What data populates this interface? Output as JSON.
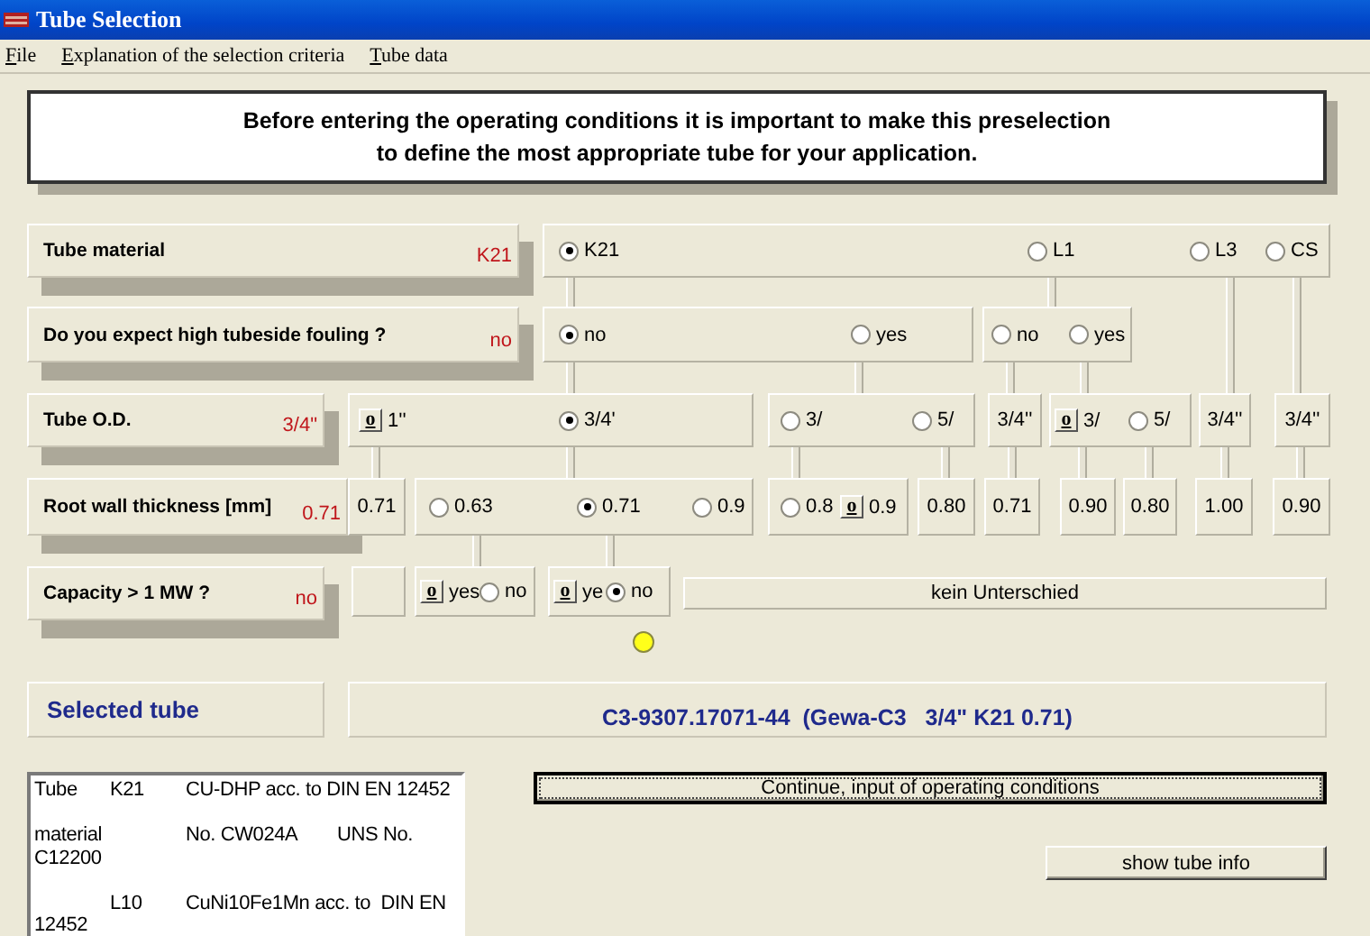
{
  "window": {
    "title": "Tube Selection"
  },
  "menu": [
    {
      "label": "File"
    },
    {
      "label": "Explanation of the selection criteria"
    },
    {
      "label": "Tube data"
    }
  ],
  "notice": "Before entering the operating conditions it is important to make this preselection\nto define the most appropriate tube for your application.",
  "criteria": [
    {
      "label": "Tube material",
      "value": "K21"
    },
    {
      "label": "Do you expect high tubeside fouling ?",
      "value": "no"
    },
    {
      "label": "Tube O.D.",
      "value": "3/4\""
    },
    {
      "label": "Root wall thickness [mm]",
      "value": "0.71"
    },
    {
      "label": "Capacity > 1 MW ?",
      "value": "no"
    }
  ],
  "tree": {
    "nodes": [
      {
        "options": [
          {
            "kind": "radio",
            "label": "K21",
            "selected": true
          },
          {
            "kind": "radio",
            "label": "L1",
            "selected": false
          },
          {
            "kind": "radio",
            "label": "L3",
            "selected": false
          },
          {
            "kind": "radio",
            "label": "CS",
            "selected": false
          }
        ]
      },
      {
        "options": [
          {
            "kind": "radio",
            "label": "no",
            "selected": true
          },
          {
            "kind": "radio",
            "label": "yes",
            "selected": false
          }
        ]
      },
      {
        "options": [
          {
            "kind": "radio",
            "label": "no",
            "selected": false
          },
          {
            "kind": "radio",
            "label": "yes",
            "selected": false
          }
        ]
      },
      {
        "options": [
          {
            "kind": "button",
            "button": "o",
            "label": "1''"
          },
          {
            "kind": "radio",
            "label": "3/4'",
            "selected": true
          }
        ]
      },
      {
        "options": [
          {
            "kind": "radio",
            "label": "3/",
            "selected": false
          },
          {
            "kind": "radio",
            "label": "5/",
            "selected": false
          }
        ]
      },
      {
        "options": [
          {
            "kind": "text",
            "label": "3/4''"
          }
        ]
      },
      {
        "options": [
          {
            "kind": "button",
            "button": "o",
            "label": "3/"
          },
          {
            "kind": "radio",
            "label": "5/",
            "selected": false
          }
        ]
      },
      {
        "options": [
          {
            "kind": "text",
            "label": "3/4''"
          }
        ]
      },
      {
        "options": [
          {
            "kind": "text",
            "label": "3/4''"
          }
        ]
      },
      {
        "options": [
          {
            "kind": "text",
            "label": "0.71"
          }
        ]
      },
      {
        "options": [
          {
            "kind": "radio",
            "label": "0.63",
            "selected": false
          },
          {
            "kind": "radio",
            "label": "0.71",
            "selected": true
          },
          {
            "kind": "radio",
            "label": "0.9",
            "selected": false
          }
        ]
      },
      {
        "options": [
          {
            "kind": "radio",
            "label": "0.8",
            "selected": false
          },
          {
            "kind": "button",
            "button": "o",
            "label": "0.9"
          }
        ]
      },
      {
        "options": [
          {
            "kind": "text",
            "label": "0.80"
          }
        ]
      },
      {
        "options": [
          {
            "kind": "text",
            "label": "0.71"
          }
        ]
      },
      {
        "options": [
          {
            "kind": "text",
            "label": "0.90"
          }
        ]
      },
      {
        "options": [
          {
            "kind": "text",
            "label": "0.80"
          }
        ]
      },
      {
        "options": [
          {
            "kind": "text",
            "label": "1.00"
          }
        ]
      },
      {
        "options": [
          {
            "kind": "text",
            "label": "0.90"
          }
        ]
      },
      {
        "kind": "empty"
      },
      {
        "options": [
          {
            "kind": "button",
            "button": "o",
            "label": "yes"
          },
          {
            "kind": "radio",
            "label": "no",
            "selected": false
          }
        ]
      },
      {
        "options": [
          {
            "kind": "button",
            "button": "o",
            "label": "ye"
          },
          {
            "kind": "radio",
            "label": "no",
            "selected": true
          }
        ]
      },
      {
        "options": [
          {
            "kind": "text",
            "label": "kein Unterschied"
          }
        ]
      }
    ]
  },
  "selected_tube": {
    "label": "Selected tube",
    "value": "C3-9307.17071-44  (Gewa-C3   3/4\" K21 0.71)"
  },
  "tube_info": "Tube\tK21\tCU-DHP acc. to DIN EN 12452\n\nmaterial\t\tNo. CW024A\tUNS No.\nC12200\n\n\tL10\tCuNi10Fe1Mn acc. to  DIN EN\n12452",
  "buttons": [
    {
      "label": "Continue, input of operating conditions"
    },
    {
      "label": "show tube info"
    }
  ]
}
